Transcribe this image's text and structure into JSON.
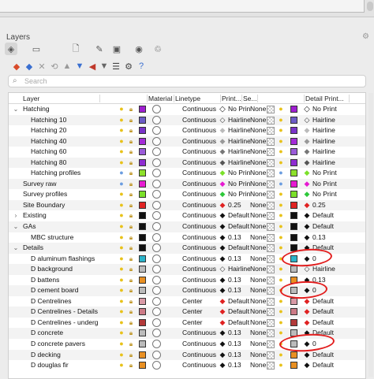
{
  "panel": {
    "title": "Layers",
    "gear": "⚙"
  },
  "tabs": [
    {
      "name": "layers-tab",
      "glyph": "◈",
      "active": true
    },
    {
      "name": "display-tab",
      "glyph": "▭",
      "active": false
    },
    {
      "name": "properties-tab",
      "glyph": "🗋",
      "active": false
    },
    {
      "name": "materials-tab",
      "glyph": "✎",
      "active": false
    },
    {
      "name": "rendering-tab",
      "glyph": "▣",
      "active": false
    },
    {
      "name": "camera-tab",
      "glyph": "◉",
      "active": false
    },
    {
      "name": "help-tab",
      "glyph": "♲",
      "active": false
    }
  ],
  "toolbar": [
    {
      "name": "new-layer-icon",
      "glyph": "◆",
      "color": "#d84b2a"
    },
    {
      "name": "new-sublayer-icon",
      "glyph": "◆",
      "color": "#3a6fd0"
    },
    {
      "name": "delete-icon",
      "glyph": "✕",
      "color": "#999999"
    },
    {
      "name": "undo-icon",
      "glyph": "⟲",
      "color": "#999999"
    },
    {
      "name": "move-up-icon",
      "glyph": "▲",
      "color": "#999999"
    },
    {
      "name": "move-down-icon",
      "glyph": "▼",
      "color": "#3a6fd0"
    },
    {
      "name": "sort-icon",
      "glyph": "◀",
      "color": "#c0392b"
    },
    {
      "name": "filter-icon",
      "glyph": "▼",
      "color": "#666666"
    },
    {
      "name": "list-icon",
      "glyph": "☰",
      "color": "#444444"
    },
    {
      "name": "settings-icon",
      "glyph": "⚙",
      "color": "#444444"
    },
    {
      "name": "help-icon",
      "glyph": "?",
      "color": "#3a6fd0"
    }
  ],
  "search": {
    "placeholder": "Search"
  },
  "columns": {
    "layer": "Layer",
    "material": "Material",
    "linetype": "Linetype",
    "print_width": "Print...",
    "section": "Se...",
    "detail_print": "Detail Print..."
  },
  "rows": [
    {
      "tw": "⌄",
      "indent": 1,
      "name": "Hatching",
      "bulb": "on",
      "color": "#9f1fd1",
      "lt": "Continuous",
      "pd": "◆",
      "pdc": "#ffffff",
      "pw": "No Print",
      "se": "None",
      "dpd": "◆",
      "dpdc": "#ffffff",
      "dpw": "No Print"
    },
    {
      "tw": "",
      "indent": 2,
      "name": "Hatching 10",
      "bulb": "on",
      "color": "#6c5cc6",
      "lt": "Continuous",
      "pd": "◇",
      "pdc": "#ffffff",
      "pw": "Hairline",
      "se": "None",
      "dpd": "◇",
      "dpdc": "#ffffff",
      "dpw": "Hairline"
    },
    {
      "tw": "",
      "indent": 2,
      "name": "Hatching 20",
      "bulb": "on",
      "color": "#7a33c9",
      "lt": "Continuous",
      "pd": "◆",
      "pdc": "#bbbbbb",
      "pw": "Hairline",
      "se": "None",
      "dpd": "◆",
      "dpdc": "#bbbbbb",
      "dpw": "Hairline"
    },
    {
      "tw": "",
      "indent": 2,
      "name": "Hatching 40",
      "bulb": "on",
      "color": "#a42bd8",
      "lt": "Continuous",
      "pd": "◆",
      "pdc": "#999999",
      "pw": "Hairline",
      "se": "None",
      "dpd": "◆",
      "dpdc": "#999999",
      "dpw": "Hairline"
    },
    {
      "tw": "",
      "indent": 2,
      "name": "Hatching 60",
      "bulb": "on",
      "color": "#9a5bd8",
      "lt": "Continuous",
      "pd": "◆",
      "pdc": "#777777",
      "pw": "Hairline",
      "se": "None",
      "dpd": "◆",
      "dpdc": "#777777",
      "dpw": "Hairline"
    },
    {
      "tw": "",
      "indent": 2,
      "name": "Hatching 80",
      "bulb": "on",
      "color": "#8e2bd1",
      "lt": "Continuous",
      "pd": "◆",
      "pdc": "#555555",
      "pw": "Hairline",
      "se": "None",
      "dpd": "◆",
      "dpdc": "#555555",
      "dpw": "Hairline"
    },
    {
      "tw": "",
      "indent": 2,
      "name": "Hatching profiles",
      "bulb": "dim",
      "color": "#8de02a",
      "lt": "Continuous",
      "pd": "◆",
      "pdc": "#7be02a",
      "pw": "No Print",
      "se": "None",
      "dpd": "◆",
      "dpdc": "#7be02a",
      "dpw": "No Print"
    },
    {
      "tw": "",
      "indent": 1,
      "name": "Survey raw",
      "bulb": "dim",
      "color": "#e61ad1",
      "lt": "Continuous",
      "pd": "◆",
      "pdc": "#e61ad1",
      "pw": "No Print",
      "se": "None",
      "dpd": "◆",
      "dpdc": "#e61ad1",
      "dpw": "No Print"
    },
    {
      "tw": "",
      "indent": 1,
      "name": "Survey profiles",
      "bulb": "on",
      "color": "#7be02a",
      "lt": "Continuous",
      "pd": "◆",
      "pdc": "#2ec83a",
      "pw": "No Print",
      "se": "None",
      "dpd": "◆",
      "dpdc": "#2ec83a",
      "dpw": "No Print"
    },
    {
      "tw": "",
      "indent": 1,
      "name": "Site Boundary",
      "bulb": "on",
      "color": "#e02222",
      "lt": "Continuous",
      "pd": "◆",
      "pdc": "#e02222",
      "pw": "0.25",
      "se": "None",
      "dpd": "◆",
      "dpdc": "#e02222",
      "dpw": "0.25"
    },
    {
      "tw": "›",
      "indent": 1,
      "name": "Existing",
      "bulb": "on",
      "color": "#111111",
      "lt": "Continuous",
      "pd": "◆",
      "pdc": "#111111",
      "pw": "Default",
      "se": "None",
      "dpd": "◆",
      "dpdc": "#111111",
      "dpw": "Default"
    },
    {
      "tw": "⌄",
      "indent": 1,
      "name": "GAs",
      "bulb": "on",
      "color": "#111111",
      "lt": "Continuous",
      "pd": "◆",
      "pdc": "#111111",
      "pw": "Default",
      "se": "None",
      "dpd": "◆",
      "dpdc": "#111111",
      "dpw": "Default"
    },
    {
      "tw": "",
      "indent": 2,
      "name": "MBC structure",
      "bulb": "on",
      "color": "#111111",
      "lt": "Continuous",
      "pd": "◆",
      "pdc": "#111111",
      "pw": "0.13",
      "se": "None",
      "dpd": "◆",
      "dpdc": "#111111",
      "dpw": "0.13"
    },
    {
      "tw": "⌄",
      "indent": 1,
      "name": "Details",
      "bulb": "on",
      "color": "#111111",
      "lt": "Continuous",
      "pd": "◆",
      "pdc": "#111111",
      "pw": "Default",
      "se": "None",
      "dpd": "◆",
      "dpdc": "#111111",
      "dpw": "Default"
    },
    {
      "tw": "",
      "indent": 2,
      "name": "D aluminum flashings",
      "bulb": "on",
      "color": "#2bb3c9",
      "lt": "Continuous",
      "pd": "◆",
      "pdc": "#111111",
      "pw": "0.13",
      "se": "None",
      "dpd": "◆",
      "dpdc": "#111111",
      "dpw": "0"
    },
    {
      "tw": "",
      "indent": 2,
      "name": "D background",
      "bulb": "on",
      "color": "#bbbbbb",
      "lt": "Continuous",
      "pd": "◇",
      "pdc": "#ffffff",
      "pw": "Hairline",
      "se": "None",
      "dpd": "◇",
      "dpdc": "#ffffff",
      "dpw": "Hairline"
    },
    {
      "tw": "",
      "indent": 2,
      "name": "D battens",
      "bulb": "on",
      "color": "#e88f22",
      "lt": "Continuous",
      "pd": "◆",
      "pdc": "#111111",
      "pw": "0.13",
      "se": "None",
      "dpd": "◆",
      "dpdc": "#111111",
      "dpw": "0.13"
    },
    {
      "tw": "",
      "indent": 2,
      "name": "D cement board",
      "bulb": "on",
      "color": "#bbbbbb",
      "lt": "Continuous",
      "pd": "◆",
      "pdc": "#111111",
      "pw": "0.13",
      "se": "None",
      "dpd": "◆",
      "dpdc": "#111111",
      "dpw": "0"
    },
    {
      "tw": "",
      "indent": 2,
      "name": "D Centrelines",
      "bulb": "on",
      "color": "#d89aa6",
      "lt": "Center",
      "pd": "◆",
      "pdc": "#e02222",
      "pw": "Default",
      "se": "None",
      "dpd": "◆",
      "dpdc": "#e02222",
      "dpw": "Default"
    },
    {
      "tw": "",
      "indent": 2,
      "name": "D Centrelines - Details",
      "bulb": "on",
      "color": "#cc7a86",
      "lt": "Center",
      "pd": "◆",
      "pdc": "#e02222",
      "pw": "Default",
      "se": "None",
      "dpd": "◆",
      "dpdc": "#e02222",
      "dpw": "Default"
    },
    {
      "tw": "",
      "indent": 2,
      "name": "D Centrelines - underg",
      "bulb": "on",
      "color": "#b33a3a",
      "lt": "Center",
      "pd": "◆",
      "pdc": "#e02222",
      "pw": "Default",
      "se": "None",
      "dpd": "◆",
      "dpdc": "#e02222",
      "dpw": "Default"
    },
    {
      "tw": "",
      "indent": 2,
      "name": "D concrete",
      "bulb": "on",
      "color": "#bbbbbb",
      "lt": "Continuous",
      "pd": "◆",
      "pdc": "#111111",
      "pw": "0.13",
      "se": "None",
      "dpd": "◆",
      "dpdc": "#111111",
      "dpw": "Default"
    },
    {
      "tw": "",
      "indent": 2,
      "name": "D concrete pavers",
      "bulb": "on",
      "color": "#bbbbbb",
      "lt": "Continuous",
      "pd": "◆",
      "pdc": "#111111",
      "pw": "0.13",
      "se": "None",
      "dpd": "◆",
      "dpdc": "#111111",
      "dpw": "0"
    },
    {
      "tw": "",
      "indent": 2,
      "name": "D decking",
      "bulb": "on",
      "color": "#e88f22",
      "lt": "Continuous",
      "pd": "◆",
      "pdc": "#111111",
      "pw": "0.13",
      "se": "None",
      "dpd": "◆",
      "dpdc": "#111111",
      "dpw": "Default"
    },
    {
      "tw": "",
      "indent": 2,
      "name": "D douglas fir",
      "bulb": "on",
      "color": "#e88f22",
      "lt": "Continuous",
      "pd": "◆",
      "pdc": "#111111",
      "pw": "0.13",
      "se": "None",
      "dpd": "◆",
      "dpdc": "#111111",
      "dpw": "Default"
    }
  ]
}
